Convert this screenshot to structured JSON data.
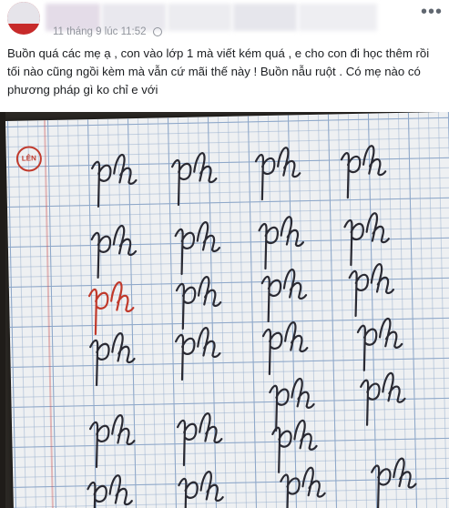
{
  "post": {
    "time_text": "11 tháng 9 lúc 11:52",
    "caption": "Buồn quá các mẹ ạ , con vào lớp 1 mà viết kém quá , e cho con đi học thêm rồi tối nào cũng ngồi kèm mà vẫn cứ mãi thế này ! Buồn nẫu ruột . Có mẹ nào có phương pháp gì ko chỉ e với",
    "more_icon": "more-horizontal-icon",
    "privacy_icon": "globe-icon"
  },
  "photo": {
    "stamp_text": "LÊN",
    "letters": "ph",
    "ink_color": "#2a2a33",
    "red_ink_color": "#c0392b",
    "grid_color": "#8da7c9"
  }
}
